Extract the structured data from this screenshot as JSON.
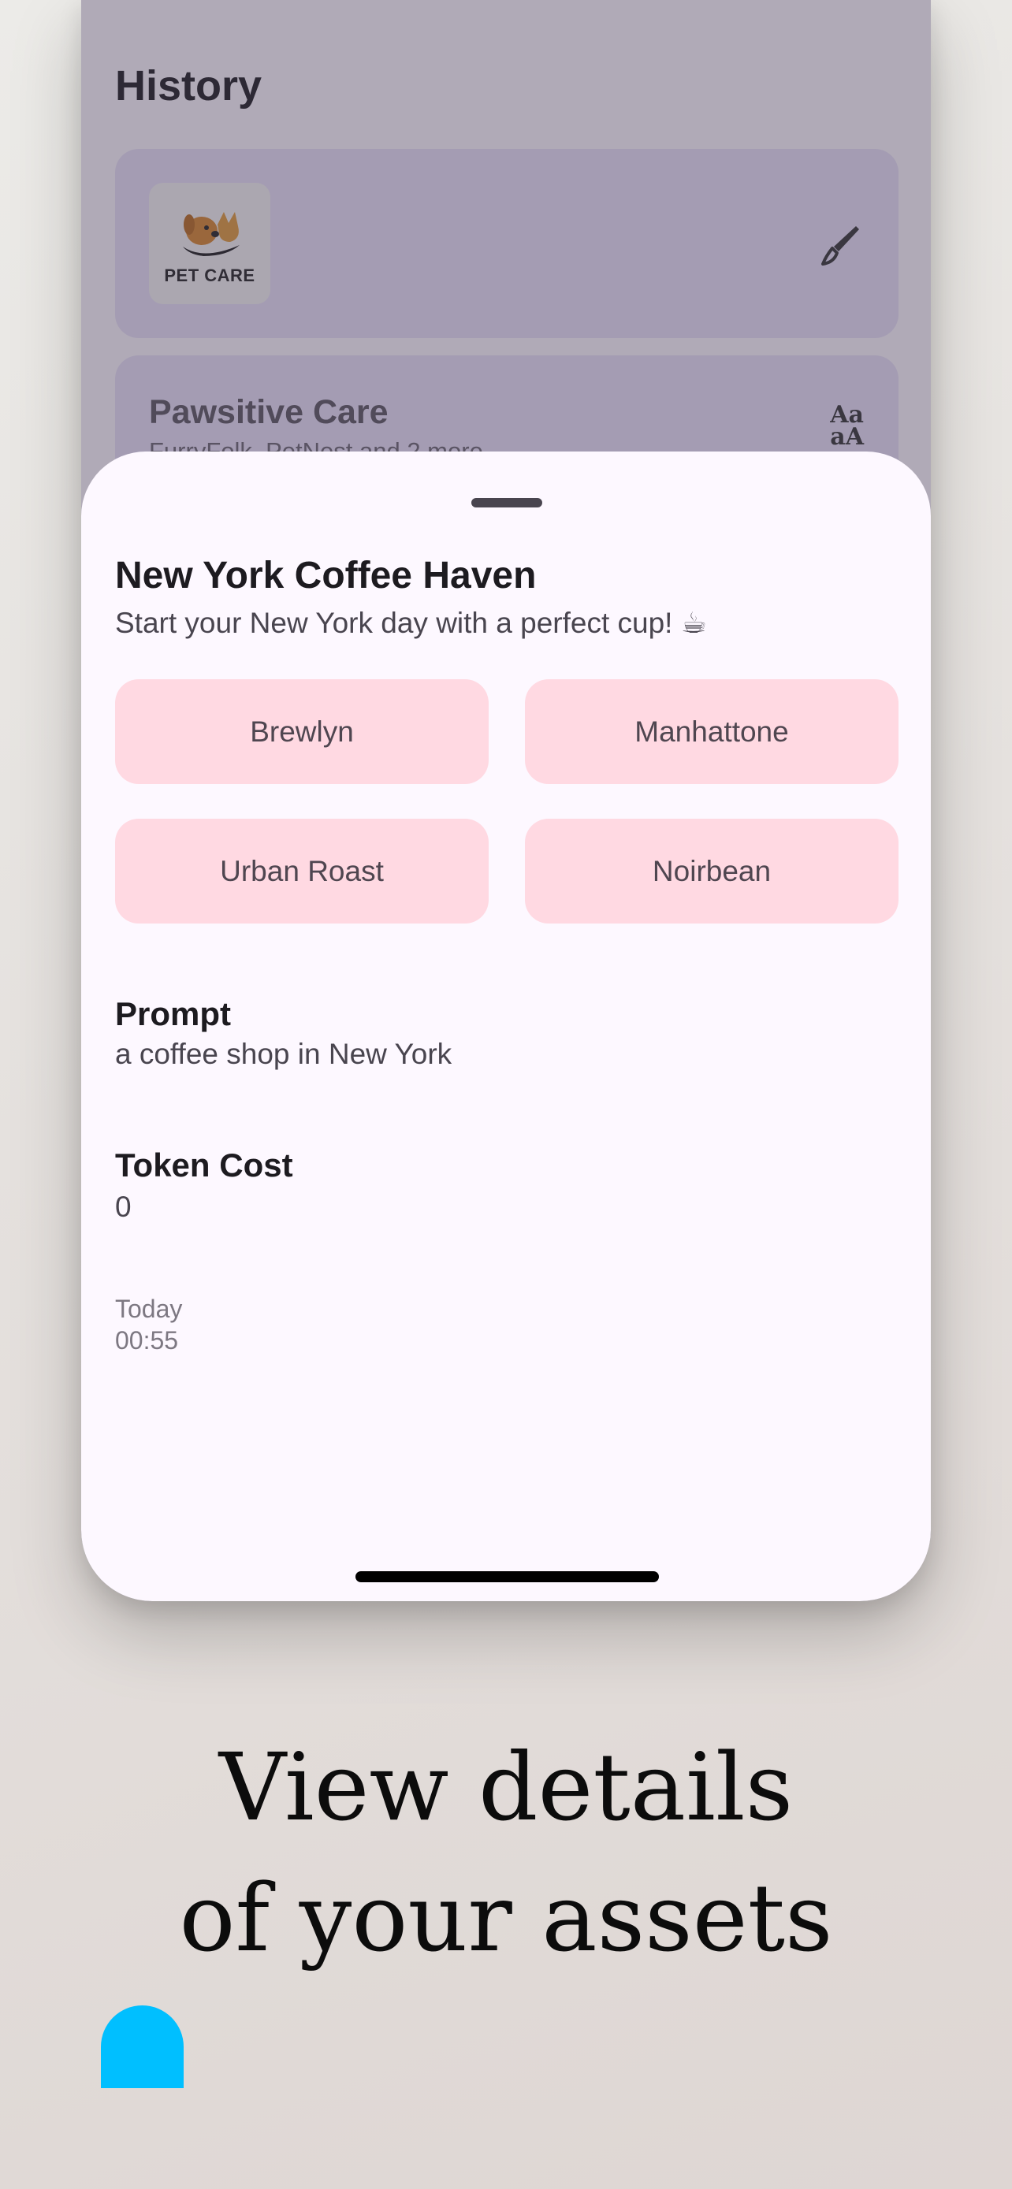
{
  "history": {
    "title": "History",
    "items": [
      {
        "logo_text": "PET CARE",
        "icon": "brush-icon"
      },
      {
        "title": "Pawsitive Care",
        "subtitle": "FurryFolk, PetNest and 2 more",
        "icon": "font-style-icon"
      }
    ]
  },
  "sheet": {
    "title": "New York Coffee Haven",
    "subtitle": "Start your New York day with a perfect cup! ☕",
    "names": [
      "Brewlyn",
      "Manhattone",
      "Urban Roast",
      "Noirbean"
    ],
    "prompt_label": "Prompt",
    "prompt_value": "a coffee shop in New York",
    "token_label": "Token Cost",
    "token_value": "0",
    "day": "Today",
    "time": "00:55"
  },
  "caption": {
    "line1": "View details",
    "line2": "of your assets"
  },
  "colors": {
    "accent_pink": "#ffd9e2",
    "card_lavender": "#e9e1f8",
    "blob_blue": "#00bfff"
  }
}
